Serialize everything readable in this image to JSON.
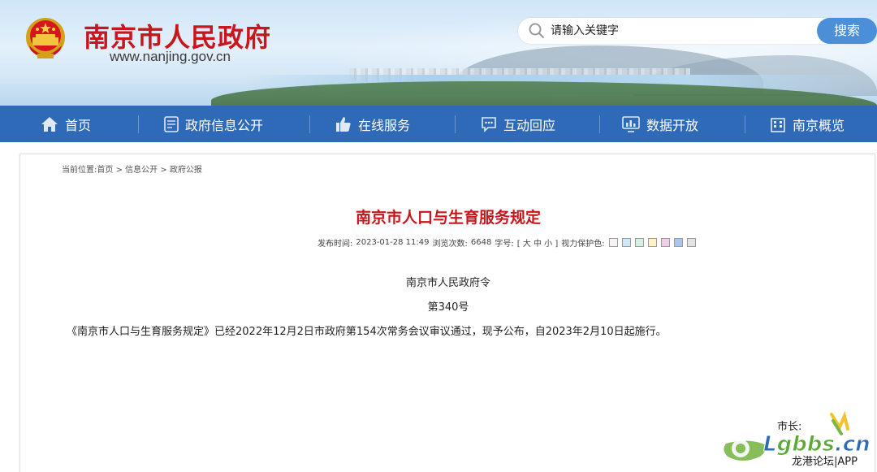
{
  "header": {
    "site_name": "南京市人民政府",
    "site_url": "www.nanjing.gov.cn",
    "search": {
      "placeholder": "请输入关键字",
      "button_label": "搜索"
    }
  },
  "nav": {
    "items": [
      {
        "label": "首页",
        "icon": "home-icon"
      },
      {
        "label": "政府信息公开",
        "icon": "document-icon"
      },
      {
        "label": "在线服务",
        "icon": "thumbs-up-icon"
      },
      {
        "label": "互动回应",
        "icon": "chat-icon"
      },
      {
        "label": "数据开放",
        "icon": "monitor-chart-icon"
      },
      {
        "label": "南京概览",
        "icon": "building-icon"
      }
    ]
  },
  "breadcrumb": {
    "prefix": "当前位置:",
    "items": [
      "首页",
      "信息公开",
      "政府公报"
    ],
    "separator": ">"
  },
  "article": {
    "title": "南京市人口与生育服务规定",
    "meta": {
      "publish_label": "发布时间:",
      "publish_time": "2023-01-28 11:49",
      "views_label": "浏览次数:",
      "views": "6648",
      "font_size_label": "字号:",
      "font_size_options": "[ 大 中 小 ]",
      "eye_care_label": "视力保护色:",
      "eye_care_colors": [
        "#f4f4f4",
        "#cfe8f7",
        "#d4f2e4",
        "#fdf3c6",
        "#f2cdeb",
        "#a9c6ef",
        "#e3e3e3"
      ]
    },
    "issuer": "南京市人民政府令",
    "order_no": "第340号",
    "body": "《南京市人口与生育服务规定》已经2022年12月2日市政府第154次常务会议审议通过，现予公布，自2023年2月10日起施行。",
    "mayor_label": "市长:"
  },
  "watermark": {
    "logo_text": "Lgbbs.cn",
    "caption": "龙港论坛|APP"
  },
  "colors": {
    "brand_red": "#c8161d",
    "nav_blue": "#2f6ab8",
    "search_blue": "#4a8fd7"
  }
}
